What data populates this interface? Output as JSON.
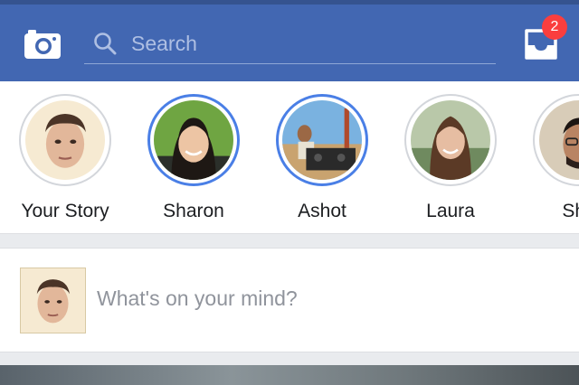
{
  "header": {
    "search_placeholder": "Search",
    "notification_count": "2",
    "icons": {
      "camera": "camera-icon",
      "search": "search-icon",
      "inbox": "inbox-icon"
    }
  },
  "stories": [
    {
      "name": "Your Story",
      "seen": true
    },
    {
      "name": "Sharon",
      "seen": false
    },
    {
      "name": "Ashot",
      "seen": false
    },
    {
      "name": "Laura",
      "seen": true
    },
    {
      "name": "Sha",
      "seen": true
    }
  ],
  "composer": {
    "prompt": "What's on your mind?"
  },
  "colors": {
    "brand": "#4267b2",
    "story_ring_unseen": "#4a7fe6",
    "badge": "#fa3e3e"
  }
}
